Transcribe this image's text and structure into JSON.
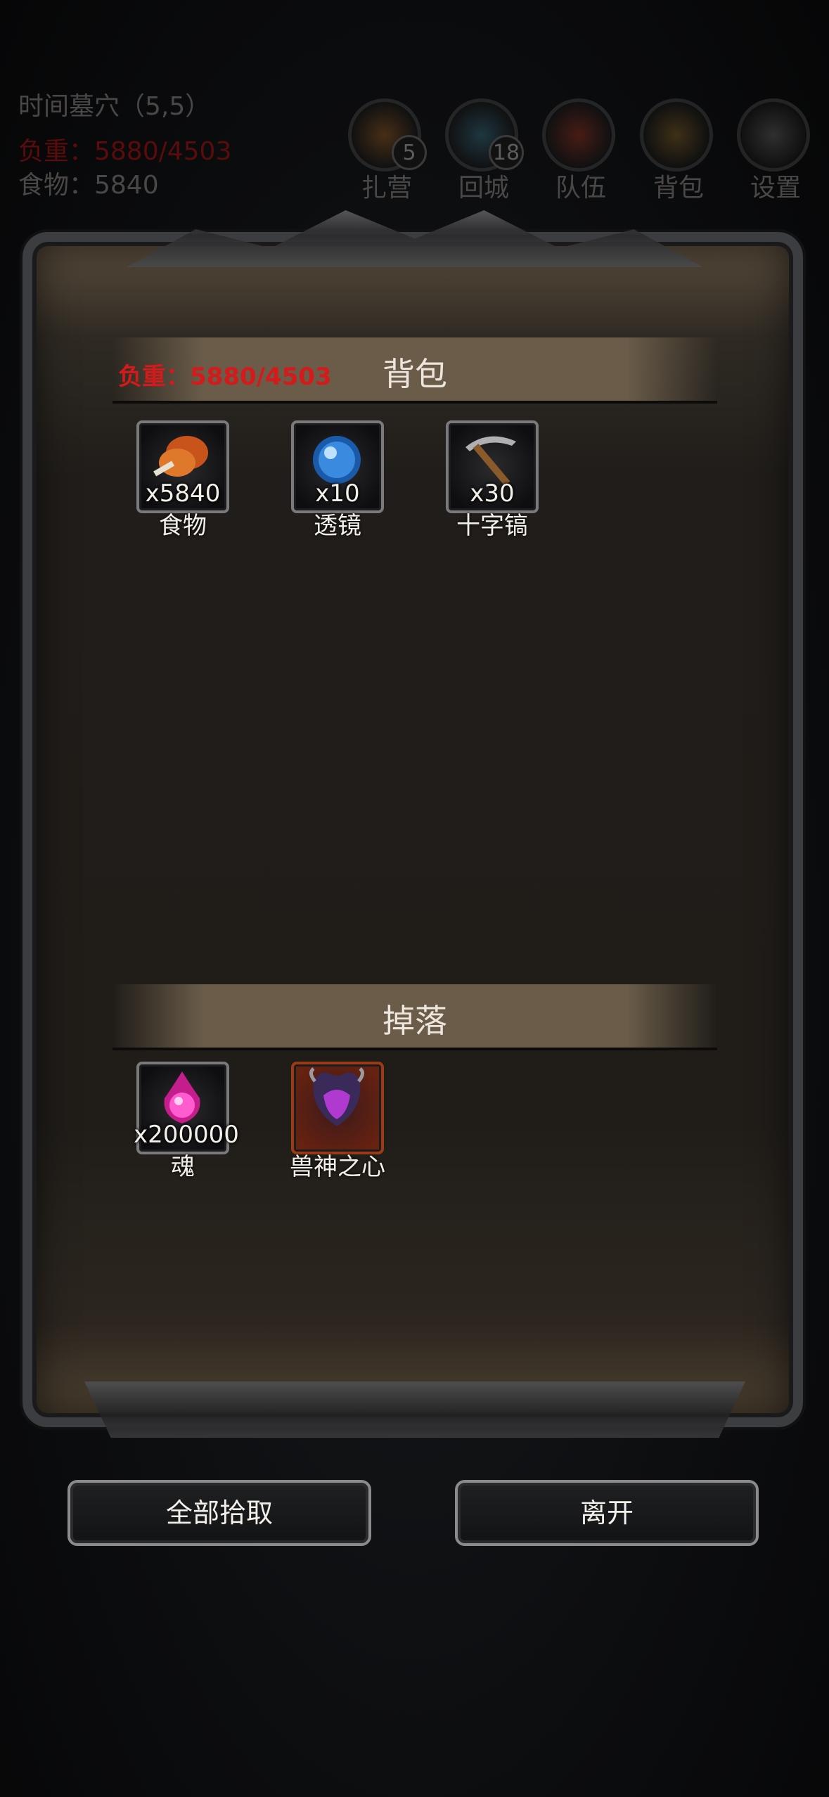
{
  "status": {
    "location": "时间墓穴（5,5）",
    "weight": "负重：5880/4503",
    "food": "食物：5840"
  },
  "menu": [
    {
      "label": "扎营",
      "badge": "5",
      "icon": "campfire-icon",
      "color": "#7a4a1c"
    },
    {
      "label": "回城",
      "badge": "18",
      "icon": "portal-icon",
      "color": "#2e5a6a"
    },
    {
      "label": "队伍",
      "badge": "",
      "icon": "team-icon",
      "color": "#7a2a1c"
    },
    {
      "label": "背包",
      "badge": "",
      "icon": "backpack-icon",
      "color": "#6a5020"
    },
    {
      "label": "设置",
      "badge": "",
      "icon": "gear-icon",
      "color": "#505050"
    }
  ],
  "bag": {
    "title": "背包",
    "weight": "负重：5880/4503",
    "items": [
      {
        "name": "食物",
        "count": "x5840",
        "icon": "meat-icon"
      },
      {
        "name": "透镜",
        "count": "x10",
        "icon": "lens-orb-icon"
      },
      {
        "name": "十字镐",
        "count": "x30",
        "icon": "pickaxe-icon"
      }
    ]
  },
  "drops": {
    "title": "掉落",
    "items": [
      {
        "name": "魂",
        "count": "x200000",
        "icon": "soul-orb-icon"
      },
      {
        "name": "兽神之心",
        "count": "",
        "icon": "beast-heart-icon"
      }
    ]
  },
  "buttons": {
    "pickup_all": "全部拾取",
    "leave": "离开"
  },
  "colors": {
    "warning_red": "#d41a1a",
    "panel_brown": "#201d1a",
    "frame_grey": "#7a7a7d"
  }
}
